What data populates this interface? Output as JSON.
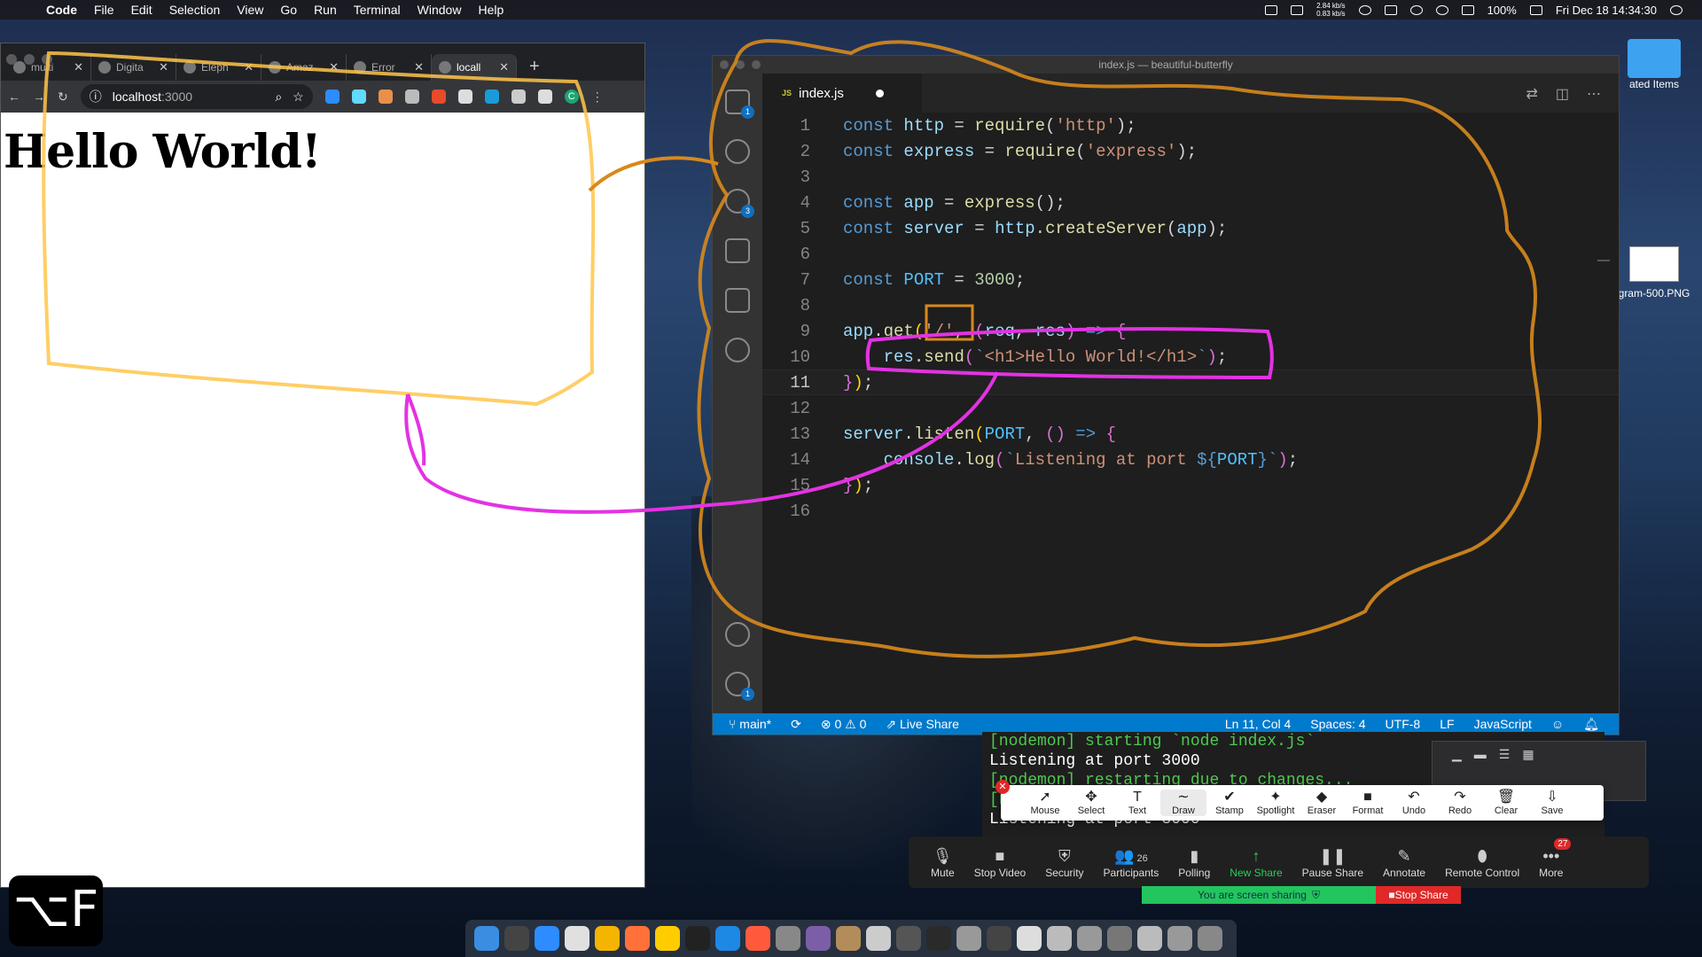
{
  "menubar": {
    "app": "Code",
    "items": [
      "File",
      "Edit",
      "Selection",
      "View",
      "Go",
      "Run",
      "Terminal",
      "Window",
      "Help"
    ],
    "net_up": "2.84 kb/s",
    "net_down": "0.83 kb/s",
    "battery": "100%",
    "datetime": "Fri Dec 18  14:34:30"
  },
  "browser": {
    "tabs": [
      {
        "label": "multi"
      },
      {
        "label": "Digita"
      },
      {
        "label": "Eleph"
      },
      {
        "label": "Amaz"
      },
      {
        "label": "Error"
      },
      {
        "label": "locall"
      }
    ],
    "new_tab": "+",
    "url_host": "localhost",
    "url_port": ":3000",
    "profile_letter": "C",
    "heading": "Hello World!"
  },
  "vscode": {
    "title": "index.js — beautiful-butterfly",
    "tab_label": "index.js",
    "tab_type": "JS",
    "badges": {
      "explorer": "1",
      "scm": "3",
      "settings": "1"
    },
    "code_lines": [
      [
        [
          "kw",
          "const "
        ],
        [
          "var",
          "http"
        ],
        [
          "pn",
          " = "
        ],
        [
          "fn",
          "require"
        ],
        [
          "pn",
          "("
        ],
        [
          "str",
          "'http'"
        ],
        [
          "pn",
          ");"
        ]
      ],
      [
        [
          "kw",
          "const "
        ],
        [
          "var",
          "express"
        ],
        [
          "pn",
          " = "
        ],
        [
          "fn",
          "require"
        ],
        [
          "pn",
          "("
        ],
        [
          "str",
          "'express'"
        ],
        [
          "pn",
          ");"
        ]
      ],
      [],
      [
        [
          "kw",
          "const "
        ],
        [
          "var",
          "app"
        ],
        [
          "pn",
          " = "
        ],
        [
          "fn",
          "express"
        ],
        [
          "pn",
          "();"
        ]
      ],
      [
        [
          "kw",
          "const "
        ],
        [
          "var",
          "server"
        ],
        [
          "pn",
          " = "
        ],
        [
          "var",
          "http"
        ],
        [
          "pn",
          "."
        ],
        [
          "fn",
          "createServer"
        ],
        [
          "pn",
          "("
        ],
        [
          "var",
          "app"
        ],
        [
          "pn",
          ");"
        ]
      ],
      [],
      [
        [
          "kw",
          "const "
        ],
        [
          "cst",
          "PORT"
        ],
        [
          "pn",
          " = "
        ],
        [
          "num",
          "3000"
        ],
        [
          "pn",
          ";"
        ]
      ],
      [],
      [
        [
          "var",
          "app"
        ],
        [
          "pn",
          "."
        ],
        [
          "fn",
          "get"
        ],
        [
          "br1",
          "("
        ],
        [
          "str",
          "'/'"
        ],
        [
          "pn",
          ", "
        ],
        [
          "br2",
          "("
        ],
        [
          "var",
          "req"
        ],
        [
          "pn",
          ", "
        ],
        [
          "var",
          "res"
        ],
        [
          "br2",
          ")"
        ],
        [
          "pn",
          " "
        ],
        [
          "kw",
          "=>"
        ],
        [
          "pn",
          " "
        ],
        [
          "br2",
          "{"
        ]
      ],
      [
        [
          "pn",
          "    "
        ],
        [
          "var",
          "res"
        ],
        [
          "pn",
          "."
        ],
        [
          "fn",
          "send"
        ],
        [
          "br2",
          "("
        ],
        [
          "tpl",
          "`"
        ],
        [
          "str",
          "<h1>Hello World!</h1>"
        ],
        [
          "tpl",
          "`"
        ],
        [
          "br2",
          ")"
        ],
        [
          "pn",
          ";"
        ]
      ],
      [
        [
          "br2",
          "}"
        ],
        [
          "br1",
          ")"
        ],
        [
          "pn",
          ";"
        ]
      ],
      [],
      [
        [
          "var",
          "server"
        ],
        [
          "pn",
          "."
        ],
        [
          "fn",
          "listen"
        ],
        [
          "br1",
          "("
        ],
        [
          "cst",
          "PORT"
        ],
        [
          "pn",
          ", "
        ],
        [
          "br2",
          "()"
        ],
        [
          "pn",
          " "
        ],
        [
          "kw",
          "=>"
        ],
        [
          "pn",
          " "
        ],
        [
          "br2",
          "{"
        ]
      ],
      [
        [
          "pn",
          "    "
        ],
        [
          "var",
          "console"
        ],
        [
          "pn",
          "."
        ],
        [
          "fn",
          "log"
        ],
        [
          "br2",
          "("
        ],
        [
          "tpl",
          "`"
        ],
        [
          "str",
          "Listening at port "
        ],
        [
          "kw",
          "${"
        ],
        [
          "cst",
          "PORT"
        ],
        [
          "kw",
          "}"
        ],
        [
          "tpl",
          "`"
        ],
        [
          "br2",
          ")"
        ],
        [
          "pn",
          ";"
        ]
      ],
      [
        [
          "br2",
          "}"
        ],
        [
          "br1",
          ")"
        ],
        [
          "pn",
          ";"
        ]
      ],
      []
    ],
    "current_line": 11,
    "status": {
      "branch": "main*",
      "problems": "⊗ 0 ⚠ 0",
      "live_share": "Live Share",
      "position": "Ln 11, Col 4",
      "spaces": "Spaces: 4",
      "encoding": "UTF-8",
      "eol": "LF",
      "language": "JavaScript"
    }
  },
  "terminal": {
    "lines": [
      {
        "text": "[nodemon] starting `node index.js`",
        "color": "green"
      },
      {
        "text": "Listening at port 3000",
        "color": "white"
      },
      {
        "text": "[nodemon] restarting due to changes...",
        "color": "green"
      },
      {
        "text": "[nodemon] starting `node index.js`",
        "color": "green"
      },
      {
        "text": "Listening at port 3000",
        "color": "white"
      }
    ]
  },
  "annotate_toolbar": {
    "tools": [
      {
        "label": "Mouse",
        "icon": "➚"
      },
      {
        "label": "Select",
        "icon": "✥"
      },
      {
        "label": "Text",
        "icon": "T"
      },
      {
        "label": "Draw",
        "icon": "∼"
      },
      {
        "label": "Stamp",
        "icon": "✔"
      },
      {
        "label": "Spotlight",
        "icon": "✦"
      },
      {
        "label": "Eraser",
        "icon": "◆"
      },
      {
        "label": "Format",
        "icon": "■"
      },
      {
        "label": "Undo",
        "icon": "↶"
      },
      {
        "label": "Redo",
        "icon": "↷"
      },
      {
        "label": "Clear",
        "icon": "🗑"
      },
      {
        "label": "Save",
        "icon": "⇩"
      }
    ]
  },
  "zoom": {
    "items": [
      {
        "label": "Mute",
        "icon": "🎙"
      },
      {
        "label": "Stop Video",
        "icon": "■"
      },
      {
        "label": "Security",
        "icon": "⛨"
      },
      {
        "label": "Participants",
        "icon": "👥"
      },
      {
        "label": "Polling",
        "icon": "▮"
      },
      {
        "label": "New Share",
        "icon": "↑"
      },
      {
        "label": "Pause Share",
        "icon": "❚❚"
      },
      {
        "label": "Annotate",
        "icon": "✎"
      },
      {
        "label": "Remote Control",
        "icon": "⬮"
      },
      {
        "label": "More",
        "icon": "•••"
      }
    ],
    "participants_count": "26",
    "more_badge": "27",
    "sharing_text": "You are screen sharing",
    "stop_share": "Stop Share"
  },
  "desktop": {
    "folder_label": "ated Items",
    "file_label": "gram-500.PNG"
  },
  "logo_text": "⌥F"
}
